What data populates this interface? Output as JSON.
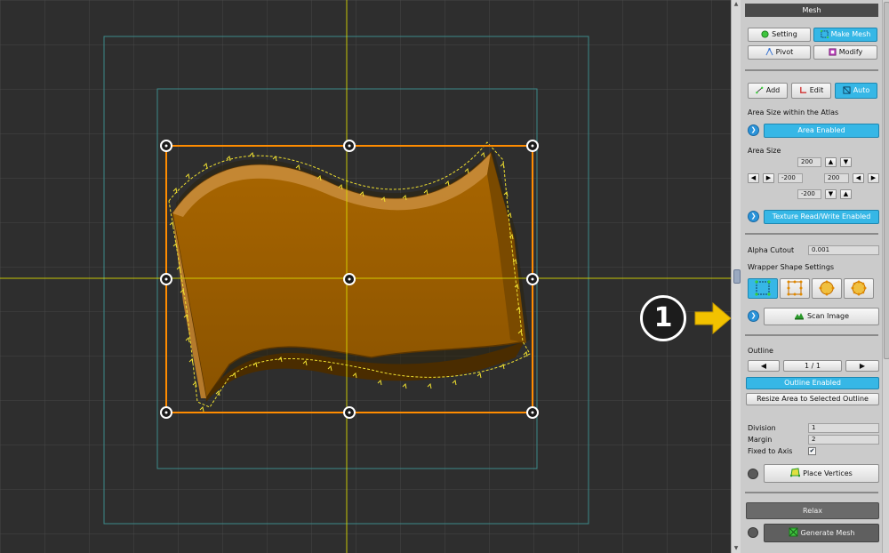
{
  "panel": {
    "title": "Mesh",
    "top_tabs": [
      "Setting",
      "Make Mesh",
      "Pivot",
      "Modify"
    ],
    "mode_tabs": [
      "Add",
      "Edit",
      "Auto"
    ],
    "area_size_within_atlas_label": "Area Size within the Atlas",
    "area_enabled_button": "Area Enabled",
    "area_size_label": "Area Size",
    "area_size": {
      "top": "200",
      "left": "-200",
      "right": "200",
      "bottom": "-200"
    },
    "texture_rw_button": "Texture Read/Write Enabled",
    "alpha_cutout_label": "Alpha Cutout",
    "alpha_cutout_value": "0.001",
    "wrapper_shape_label": "Wrapper Shape Settings",
    "scan_image_button": "Scan Image",
    "outline_label": "Outline",
    "outline_page": "1 / 1",
    "outline_enabled_button": "Outline Enabled",
    "resize_area_button": "Resize Area to Selected Outline",
    "division_label": "Division",
    "division_value": "1",
    "margin_label": "Margin",
    "margin_value": "2",
    "fixed_axis_label": "Fixed to Axis",
    "fixed_axis_checked": true,
    "place_vertices_button": "Place Vertices",
    "relax_button": "Relax",
    "generate_mesh_button": "Generate Mesh"
  },
  "callout": {
    "number": "1",
    "arrow_color": "#f2c200"
  },
  "colors": {
    "accent_blue": "#36b7e6",
    "mesh_orange": "#b36a00",
    "guide_yellow": "#f2e600",
    "bound_orange": "#ff8c00"
  }
}
